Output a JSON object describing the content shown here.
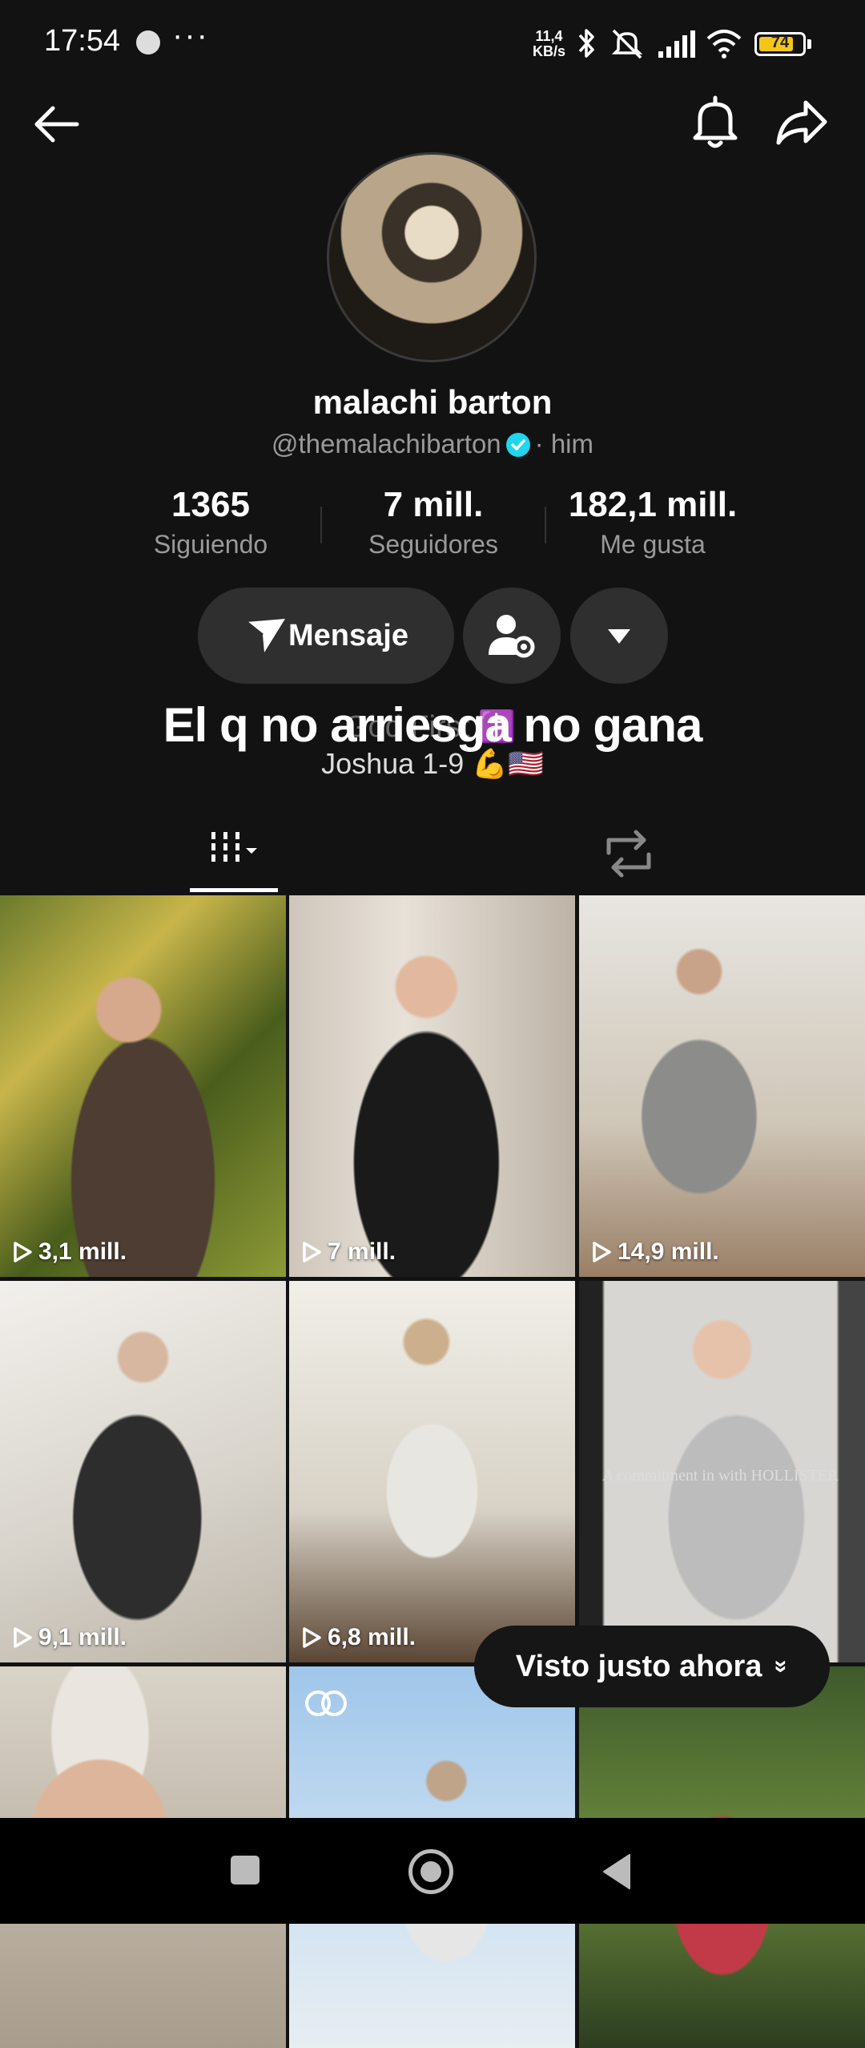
{
  "status_bar": {
    "time": "17:54",
    "more": "···",
    "net_speed_value": "11,4",
    "net_speed_unit": "KB/s",
    "battery": "74"
  },
  "header": {
    "back_icon": "arrow-left-icon",
    "bell_icon": "bell-icon",
    "share_icon": "share-arrow-icon"
  },
  "profile": {
    "display_name": "malachi barton",
    "handle": "@themalachibarton",
    "pronouns": "· him"
  },
  "stats": [
    {
      "value": "1365",
      "label": "Siguiendo"
    },
    {
      "value": "7 mill.",
      "label": "Seguidores"
    },
    {
      "value": "182,1 mill.",
      "label": "Me gusta"
    }
  ],
  "actions": {
    "message_label": "Mensaje"
  },
  "bio": {
    "main": "El q no arriesga no gana",
    "ghost": "God First ✝️",
    "sub": "Joshua 1-9 💪🇺🇸"
  },
  "videos": [
    {
      "views": "3,1 mill."
    },
    {
      "views": "7 mill."
    },
    {
      "views": "14,9 mill."
    },
    {
      "views": "9,1 mill."
    },
    {
      "views": "6,8 mill."
    },
    {
      "views": ""
    },
    {
      "views": ""
    },
    {
      "views": ""
    },
    {
      "views": ""
    }
  ],
  "overlay_text": "A commitment in with HOLLISTER",
  "toast": {
    "label": "Visto justo ahora",
    "chevron": "»"
  },
  "colors": {
    "background": "#121212",
    "button": "#2f2f2f",
    "verified": "#20d5ec",
    "battery": "#f5c518"
  }
}
